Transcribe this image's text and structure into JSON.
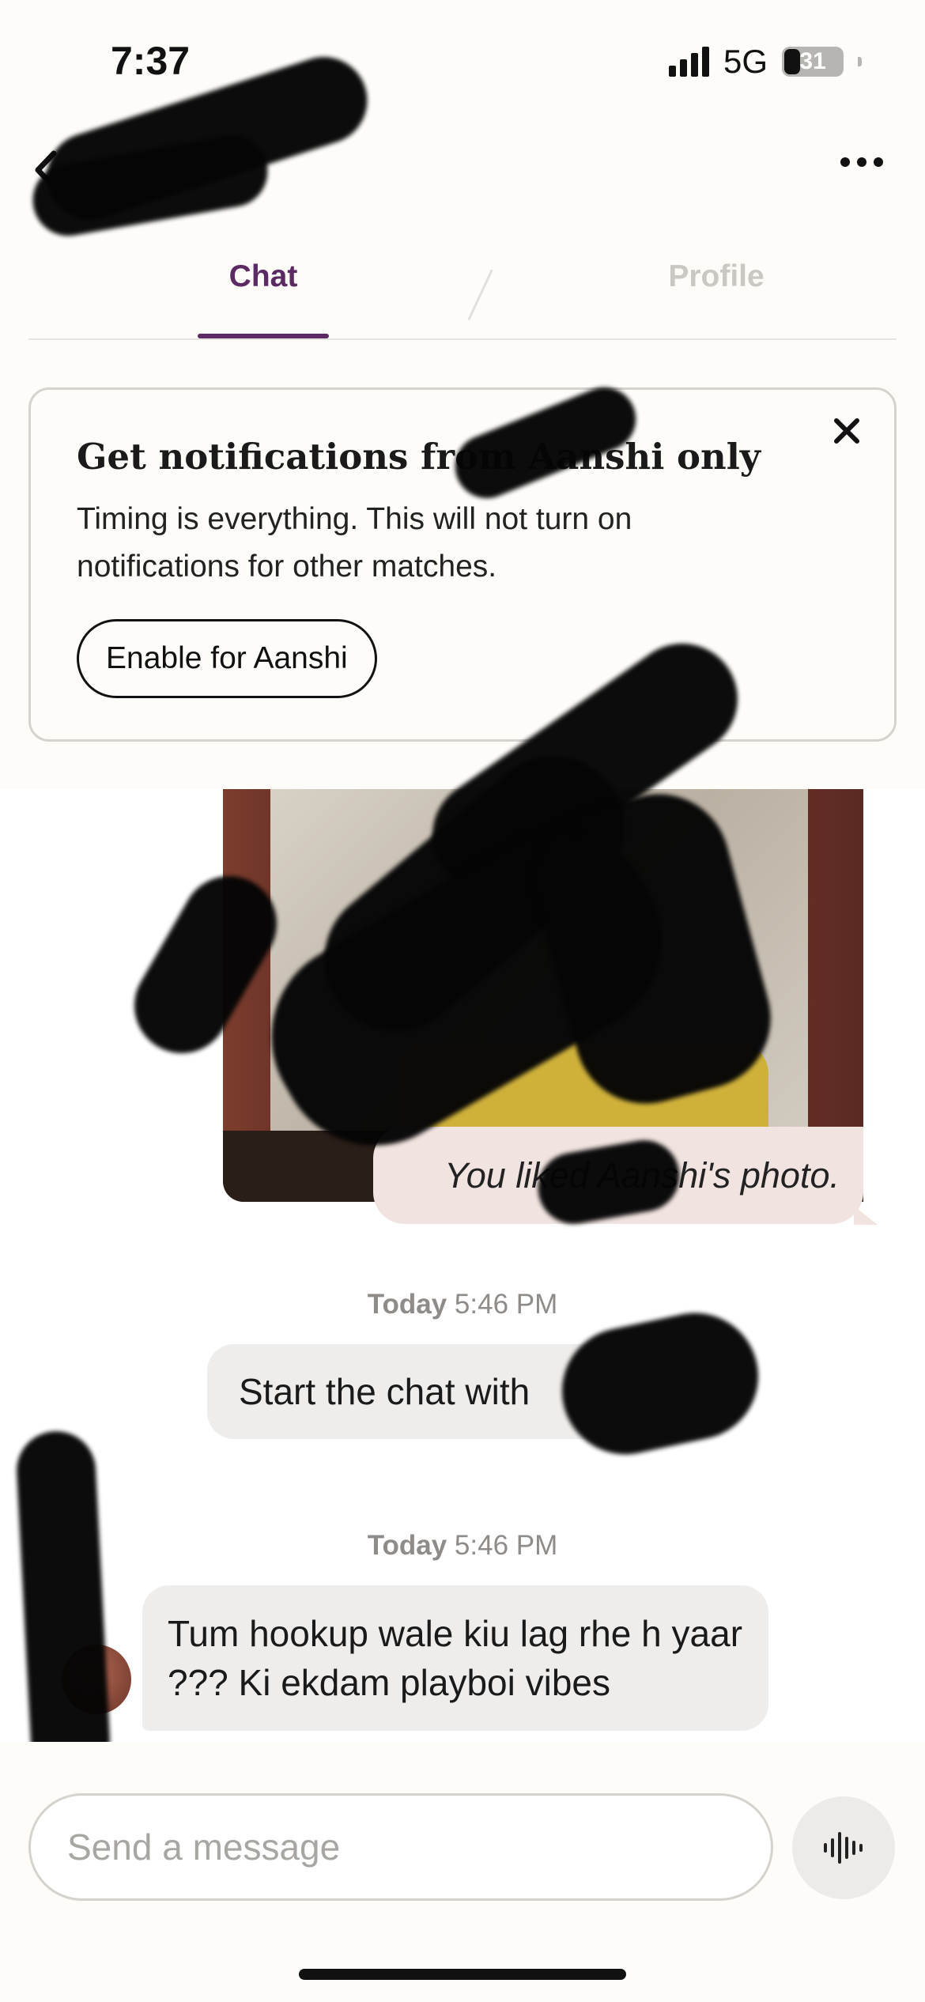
{
  "status_bar": {
    "time": "7:37",
    "network": "5G",
    "battery": "31",
    "battery_level_percent": 31
  },
  "header": {
    "back_icon": "chevron-left-icon",
    "name": "",
    "more_icon": "ellipsis-icon"
  },
  "tabs": [
    {
      "label": "Chat",
      "active": true
    },
    {
      "label": "Profile",
      "active": false
    }
  ],
  "notification": {
    "title": "Get notifications from Aanshi only",
    "body": "Timing is everything. This will not turn on notifications for other matches.",
    "button_label": "Enable for Aanshi",
    "close_icon": "close-icon"
  },
  "photo_like": {
    "caption": "You liked Aanshi's photo."
  },
  "timestamps": [
    {
      "day": "Today",
      "time": "5:46 PM"
    },
    {
      "day": "Today",
      "time": "5:46 PM"
    }
  ],
  "messages": [
    {
      "direction": "outgoing",
      "text": "Start the chat with"
    },
    {
      "direction": "incoming",
      "text": "Tum hookup wale kiu lag rhe h yaar ??? Ki ekdam playboi vibes"
    }
  ],
  "composer": {
    "placeholder": "Send a message",
    "voice_icon": "voice-waveform-icon"
  },
  "colors": {
    "accent": "#5c2a63",
    "background": "#fdfcf9",
    "bubble": "#eeedeb",
    "like_bubble": "#f1e4e0"
  }
}
